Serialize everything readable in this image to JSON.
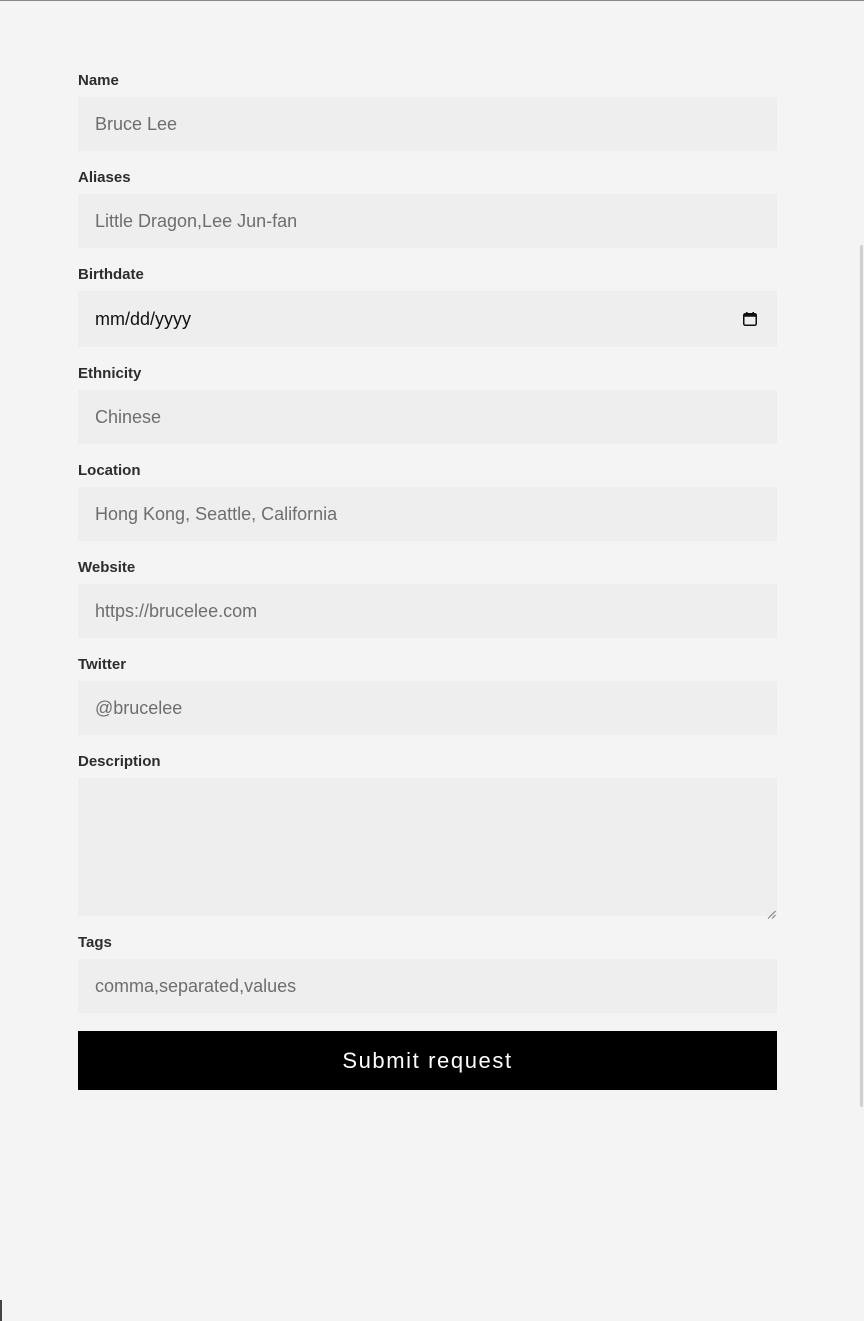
{
  "form": {
    "fields": [
      {
        "label": "Name",
        "placeholder": "Bruce Lee"
      },
      {
        "label": "Aliases",
        "placeholder": "Little Dragon,Lee Jun-fan"
      },
      {
        "label": "Birthdate",
        "placeholder": "mm/dd/yyyy"
      },
      {
        "label": "Ethnicity",
        "placeholder": "Chinese"
      },
      {
        "label": "Location",
        "placeholder": "Hong Kong, Seattle, California"
      },
      {
        "label": "Website",
        "placeholder": "https://brucelee.com"
      },
      {
        "label": "Twitter",
        "placeholder": "@brucelee"
      },
      {
        "label": "Description",
        "placeholder": ""
      },
      {
        "label": "Tags",
        "placeholder": "comma,separated,values"
      }
    ],
    "submit_label": "Submit request"
  },
  "icons": {
    "birthdate_picker": "calendar-icon",
    "description_resize": "resize-handle-icon"
  },
  "colors": {
    "page_background": "#f4f4f4",
    "input_background": "#eeeeee",
    "button_background": "#000000",
    "button_text": "#ffffff",
    "placeholder_text": "#6e6e6e"
  }
}
